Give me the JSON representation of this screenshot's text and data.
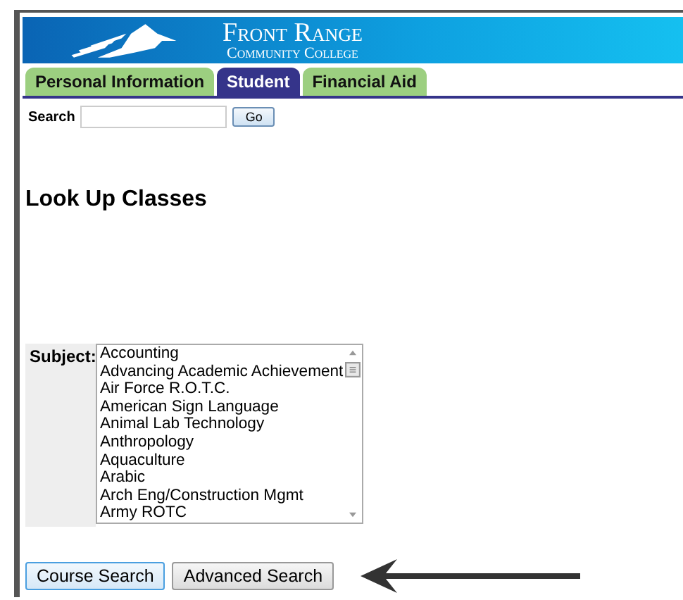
{
  "banner": {
    "title": "Front Range",
    "subtitle": "Community College"
  },
  "tabs": [
    {
      "label": "Personal Information",
      "selected": false
    },
    {
      "label": "Student",
      "selected": true
    },
    {
      "label": "Financial Aid",
      "selected": false
    }
  ],
  "search": {
    "label": "Search",
    "button": "Go"
  },
  "heading": "Look Up Classes",
  "subject": {
    "label": "Subject:",
    "options": [
      "Accounting",
      "Advancing Academic Achievement",
      "Air Force R.O.T.C.",
      "American Sign Language",
      "Animal Lab Technology",
      "Anthropology",
      "Aquaculture",
      "Arabic",
      "Arch Eng/Construction Mgmt",
      "Army ROTC"
    ]
  },
  "buttons": [
    {
      "label": "Course Search",
      "focused": true
    },
    {
      "label": "Advanced Search",
      "focused": false
    }
  ]
}
